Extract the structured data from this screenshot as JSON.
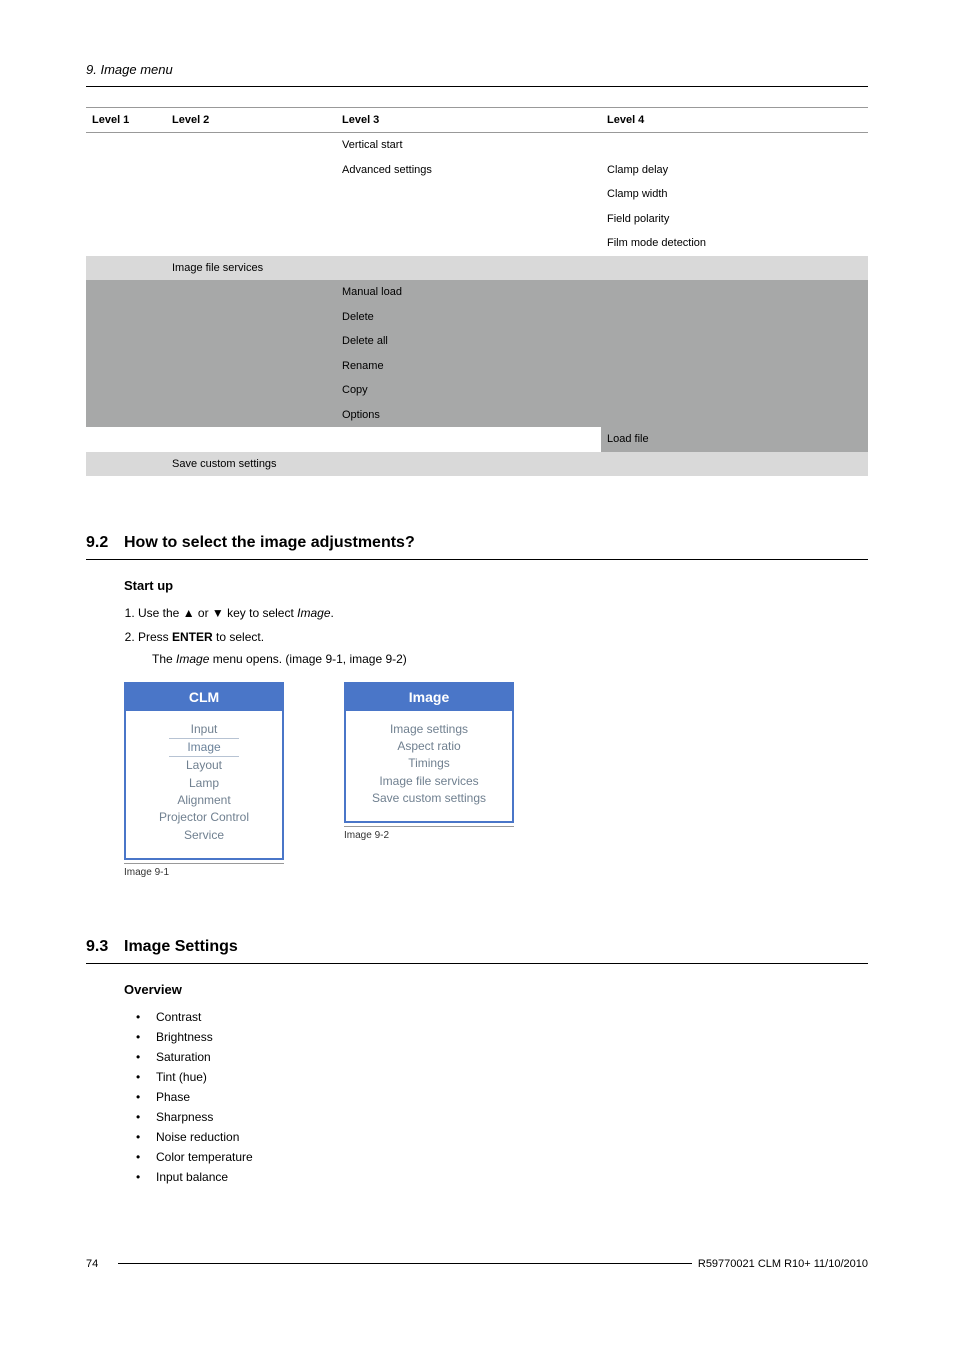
{
  "chapter_header": "9.  Image menu",
  "table": {
    "headers": [
      "Level 1",
      "Level 2",
      "Level 3",
      "Level 4"
    ],
    "rows": [
      {
        "c3": "Vertical start"
      },
      {
        "c3": "Advanced settings",
        "c4": "Clamp delay"
      },
      {
        "c4": "Clamp width"
      },
      {
        "c4": "Field polarity"
      },
      {
        "c4": "Film mode detection"
      },
      {
        "c2": "Image file services",
        "shade2": true
      },
      {
        "c3": "Manual load",
        "darkRow": true
      },
      {
        "c3": "Delete",
        "darkRow": true
      },
      {
        "c3": "Delete all",
        "darkRow": true
      },
      {
        "c3": "Rename",
        "darkRow": true
      },
      {
        "c3": "Copy",
        "darkRow": true
      },
      {
        "c3": "Options",
        "darkRow": true
      },
      {
        "c4": "Load file",
        "shade4": true
      },
      {
        "c2": "Save custom settings",
        "shade2": true
      }
    ]
  },
  "section92": {
    "num": "9.2",
    "title": "How to select the image adjustments?",
    "subhead": "Start up",
    "step1_a": "Use the ▲ or ▼ key to select ",
    "step1_em": "Image",
    "step1_b": ".",
    "step2_a": "Press ",
    "step2_b": " to select.",
    "enter": "ENTER",
    "note_a": "The ",
    "note_em": "Image",
    "note_b": " menu opens.  (image 9-1, image 9-2)",
    "fig1": {
      "title": "CLM",
      "items": [
        "Input",
        "Image",
        "Layout",
        "Lamp",
        "Alignment",
        "Projector Control",
        "Service"
      ],
      "sel_index": 1,
      "caption": "Image 9-1"
    },
    "fig2": {
      "title": "Image",
      "items": [
        "Image settings",
        "Aspect ratio",
        "Timings",
        "Image file services",
        "Save custom settings"
      ],
      "caption": "Image 9-2"
    }
  },
  "section93": {
    "num": "9.3",
    "title": "Image Settings",
    "subhead": "Overview",
    "bullets": [
      "Contrast",
      "Brightness",
      "Saturation",
      "Tint (hue)",
      "Phase",
      "Sharpness",
      "Noise reduction",
      "Color temperature",
      "Input balance"
    ]
  },
  "footer": {
    "page": "74",
    "doc": "R59770021 CLM R10+  11/10/2010"
  }
}
